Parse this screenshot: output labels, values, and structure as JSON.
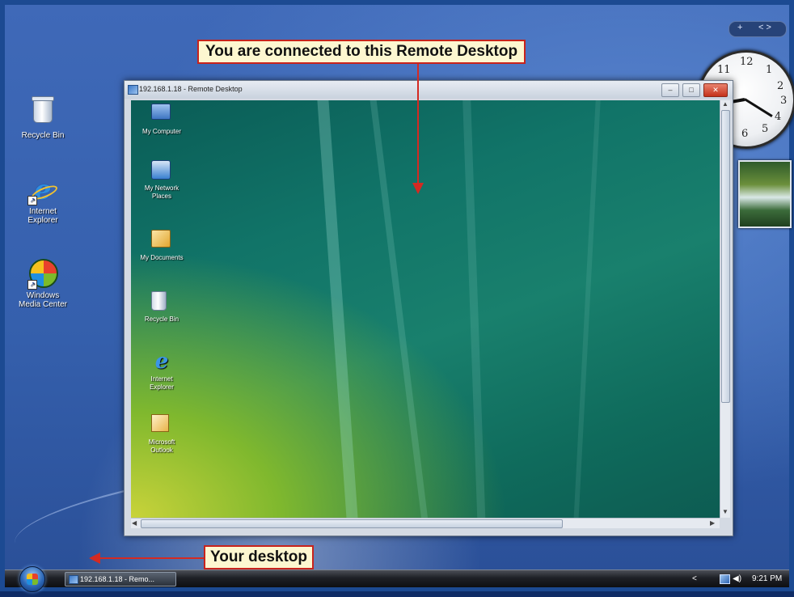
{
  "callouts": {
    "remote": "You are connected to this Remote Desktop",
    "local": "Your desktop"
  },
  "host_desktop_icons": [
    {
      "label": "Recycle Bin",
      "icon": "recycle-bin-icon"
    },
    {
      "label": "Internet Explorer",
      "icon": "internet-explorer-icon"
    },
    {
      "label": "Windows Media Center",
      "icon": "windows-media-center-icon"
    }
  ],
  "rdp_window": {
    "title": "192.168.1.18 - Remote Desktop",
    "buttons": {
      "minimize": "–",
      "maximize": "□",
      "close": "✕"
    }
  },
  "remote_desktop_icons": [
    {
      "label": "My Computer",
      "icon": "computer-icon"
    },
    {
      "label": "My Network Places",
      "icon": "network-icon"
    },
    {
      "label": "My Documents",
      "icon": "documents-icon"
    },
    {
      "label": "Recycle Bin",
      "icon": "recycle-bin-icon"
    },
    {
      "label": "Internet Explorer",
      "icon": "internet-explorer-icon"
    },
    {
      "label": "Microsoft Outlook",
      "icon": "outlook-icon"
    }
  ],
  "sidebar": {
    "add_label": "+",
    "nav_label": "< >"
  },
  "clock": {
    "numbers": {
      "twelve": "12",
      "one": "1",
      "two": "2",
      "three": "3",
      "four": "4",
      "five": "5",
      "six": "6",
      "eleven": "11"
    }
  },
  "taskbar": {
    "task_label": "192.168.1.18 - Remo...",
    "time": "9:21 PM",
    "tray_chevron": "<"
  },
  "colors": {
    "callout_border": "#c8231c",
    "callout_bg": "#fdf7d0",
    "frame": "#1c4a92"
  }
}
